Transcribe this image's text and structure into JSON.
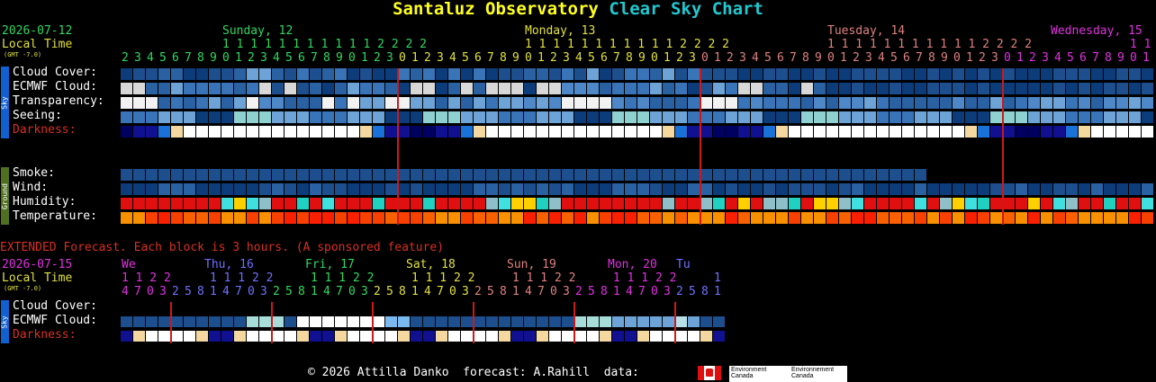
{
  "title": {
    "part1": "Santaluz Observatory",
    "part2": "Clear Sky Chart"
  },
  "colors": {
    "title_yellow": "#ffff20",
    "title_cyan": "#20c8d0",
    "green": "#30d860",
    "yellow": "#e0e040",
    "pink": "#e08080",
    "magenta": "#e030e0",
    "red_line": "#d01818",
    "orange_text": "#d83020"
  },
  "main": {
    "date": "2026-07-12",
    "local_time": "Local Time",
    "gmt": "(GMT -7.0)",
    "days": [
      "Sunday, 12",
      "Monday, 13",
      "Tuesday, 14",
      "Wednesday, 15"
    ],
    "hours_tens": "1 1 1 1 1 1 1 1 1 1 1 2 2 2 2",
    "hours_tens_last": "1 1",
    "hours_ones": "2 3 4 5 6 7 8 9 0 1 2 3 4 5 6 7 8 9 0 1 2 3 0 1 2 3 4 5 6 7 8 9 0 1 2 3 4 5 6 7 8 9 0 1 2 3 0 1 2 3 4 5 6 7 8 9 0 1 2 3 4 5 6 7 8 9 0 1 2 3 0 1 2 3 4 5 6 7 8 9 0 1",
    "sky_label": "Sky",
    "ground_label": "Ground",
    "rows": {
      "cloud": "Cloud Cover:",
      "ecmwf": "ECMWF Cloud:",
      "transparency": "Transparency:",
      "seeing": "Seeing:",
      "darkness": "Darkness:",
      "smoke": "Smoke:",
      "wind": "Wind:",
      "humidity": "Humidity:",
      "temperature": "Temperature:"
    }
  },
  "extended": {
    "banner": "EXTENDED Forecast. Each block is 3 hours. (A sponsored feature)",
    "date": "2026-07-15",
    "local_time": "Local Time",
    "gmt": "(GMT -7.0)",
    "days": [
      "We",
      "Thu, 16",
      "Fri, 17",
      "Sat, 18",
      "Sun, 19",
      "Mon, 20",
      "Tu"
    ],
    "tens": [
      "1 1 2 2",
      "1 1 1 2 2",
      "1 1 1 2 2",
      "1 1 1 2 2",
      "1 1 1 2 2",
      "1 1 1 2 2",
      "1"
    ],
    "ones": "4 7 0 3 2 5 8 1 4 7 0 3 2 5 8 1 4 7 0 3 2 5 8 1 4 7 0 3 2 5 8 1 4 7 0 3 2 5 8 1 4 7 0 3 2 5 8 1",
    "rows": {
      "cloud": "Cloud Cover:",
      "ecmwf": "ECMWF Cloud:",
      "darkness": "Darkness:"
    }
  },
  "footer": {
    "text": "© 2026 Attilla Danko  forecast: A.Rahill  data:",
    "env1a": "Environment",
    "env1b": "Canada",
    "env2a": "Environnement",
    "env2b": "Canada"
  }
}
